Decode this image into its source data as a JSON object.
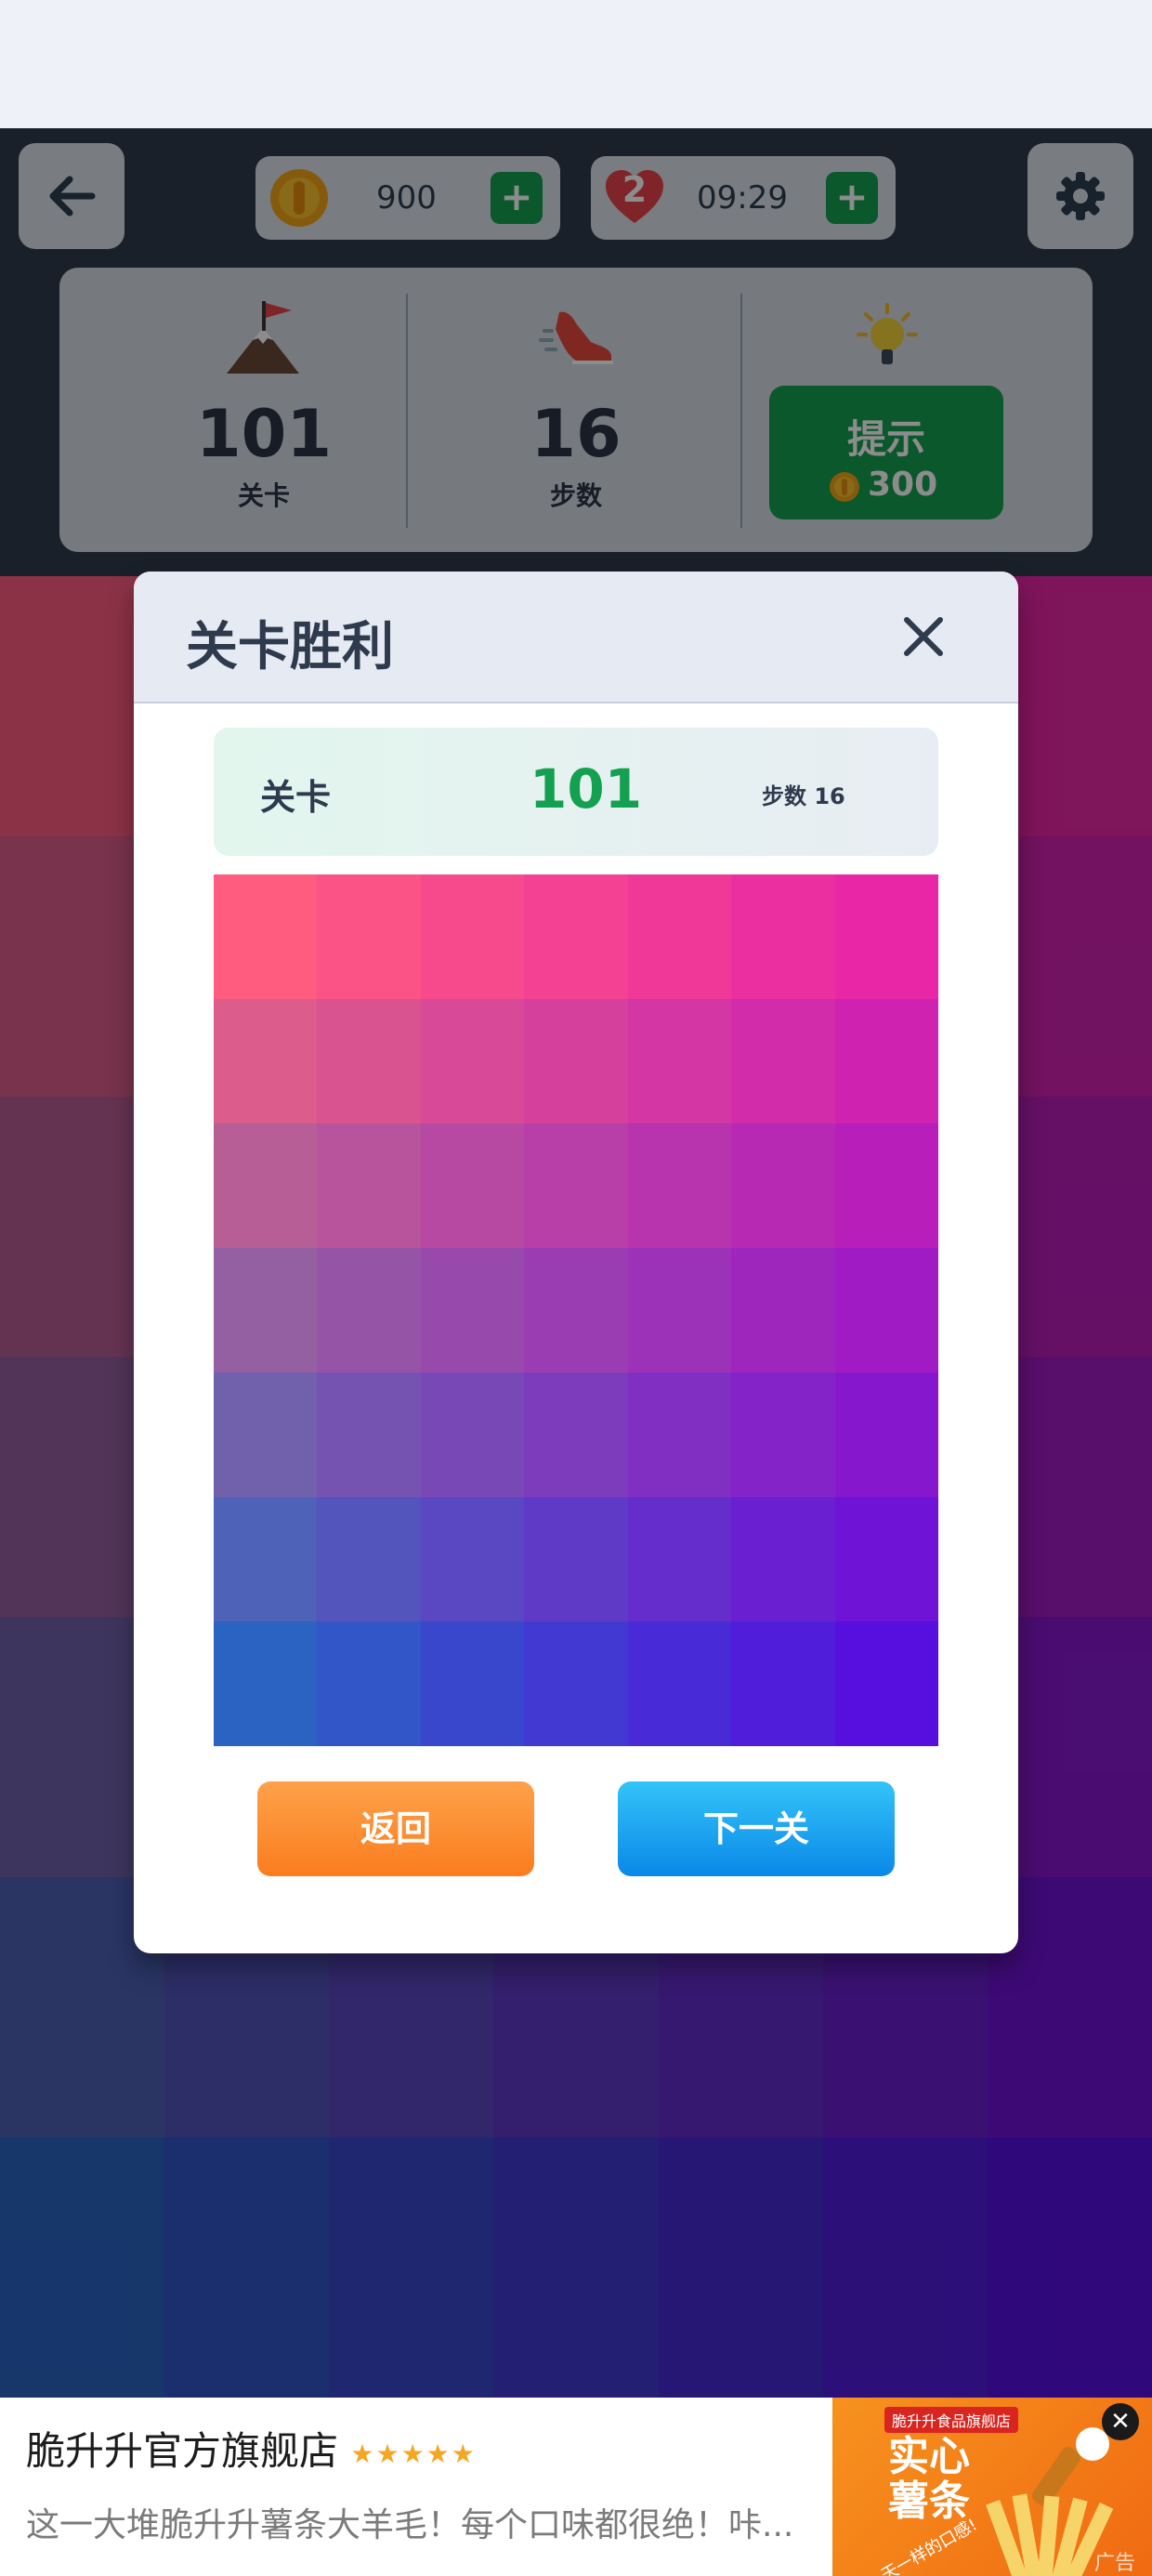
{
  "top_bar": {
    "coins": "900",
    "lives": "2",
    "timer": "09:29",
    "plus_label": "+"
  },
  "stats": {
    "level_value": "101",
    "level_label": "关卡",
    "moves_value": "16",
    "moves_label": "步数",
    "hint_label": "提示",
    "hint_cost": "300"
  },
  "modal": {
    "title": "关卡胜利",
    "summary_level_label": "关卡",
    "summary_level_value": "101",
    "summary_moves": "步数 16",
    "back_button": "返回",
    "next_button": "下一关"
  },
  "ad": {
    "title": "脆升升官方旗舰店",
    "description": "这一大堆脆升升薯条大羊毛！每个口味都很绝！咔...",
    "image_store": "脆升升食品旗舰店",
    "image_headline_1": "实心",
    "image_headline_2": "薯条",
    "image_tagline": "天一样的口感!",
    "ad_tag": "广告",
    "close_symbol": "✕"
  },
  "colors": {
    "green": "#13a050",
    "orange": "#fa7d1e",
    "blue": "#1596ee",
    "top_left_tile": "#ff5c80",
    "top_right_tile": "#e826a6",
    "bottom_left_tile": "#2a63c2",
    "bottom_right_tile": "#570fe0"
  }
}
